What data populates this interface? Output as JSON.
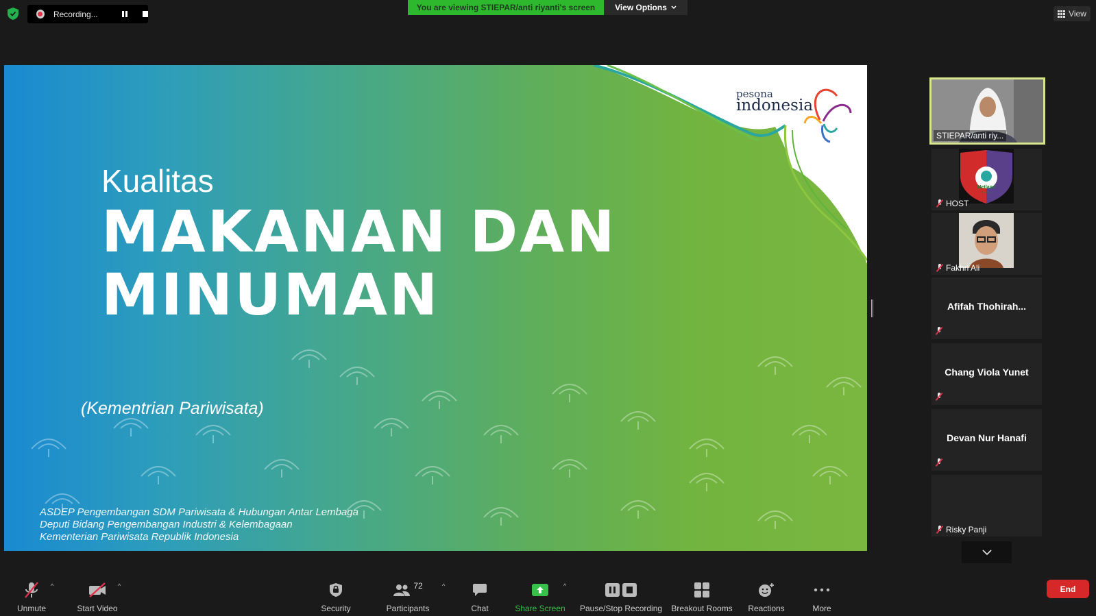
{
  "top": {
    "recording_label": "Recording...",
    "viewing_banner": "You are viewing STIEPAR/anti riyanti's screen",
    "view_options_label": "View Options",
    "view_label": "View"
  },
  "slide": {
    "kualitas": "Kualitas",
    "title_line1": "MAKANAN DAN",
    "title_line2": "MINUMAN",
    "subtitle": "(Kementrian Pariwisata)",
    "footer_line1": "ASDEP Pengembangan SDM Pariwisata & Hubungan Antar Lembaga",
    "footer_line2": "Deputi Bidang Pengembangan Industri  & Kelembagaan",
    "footer_line3": "Kementerian Pariwisata Republik Indonesia",
    "logo_top": "pesona",
    "logo_bottom": "indonesia"
  },
  "participants": [
    {
      "name": "STIEPAR/anti riy...",
      "active": true,
      "kind": "video"
    },
    {
      "name": "HOST",
      "kind": "logo",
      "logo_text": "Metland",
      "logo_sub": "SCHOOL"
    },
    {
      "name": "Fakhri Ali",
      "kind": "photo"
    },
    {
      "name": "Afifah  Thohirah...",
      "kind": "name"
    },
    {
      "name": "Chang Viola Yunet",
      "kind": "name"
    },
    {
      "name": "Devan Nur Hanafi",
      "kind": "name"
    },
    {
      "name": "Risky Panji",
      "kind": "blank"
    }
  ],
  "toolbar": {
    "unmute": "Unmute",
    "start_video": "Start Video",
    "security": "Security",
    "participants": "Participants",
    "participants_count": "72",
    "chat": "Chat",
    "share_screen": "Share Screen",
    "pause_stop": "Pause/Stop Recording",
    "breakout": "Breakout Rooms",
    "reactions": "Reactions",
    "more": "More",
    "end": "End"
  },
  "colors": {
    "banner_green": "#2eb82e",
    "end_red": "#d62828",
    "active_border": "#d9e58a",
    "share_green": "#37c04a"
  }
}
